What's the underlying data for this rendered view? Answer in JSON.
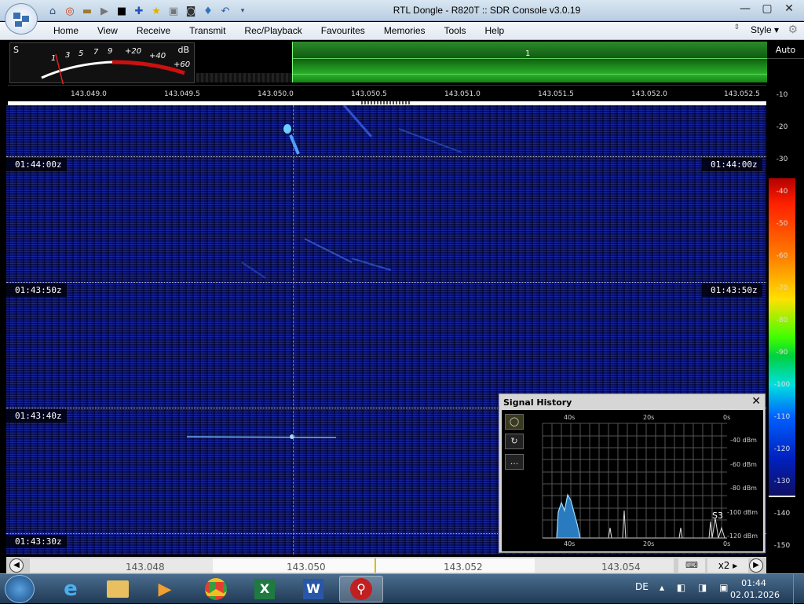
{
  "window": {
    "title": "RTL Dongle - R820T :: SDR Console v3.0.19",
    "minimize_icon": "minimize-icon",
    "maximize_icon": "maximize-icon",
    "close_icon": "close-icon"
  },
  "quick_access": [
    "home-icon",
    "lifebuoy-icon",
    "folder-icon",
    "play-icon",
    "stop-icon",
    "add-icon",
    "star-icon",
    "lock-icon",
    "camera-icon",
    "droplet-icon",
    "undo-icon",
    "dropdown-icon"
  ],
  "menu": {
    "items": [
      "Home",
      "View",
      "Receive",
      "Transmit",
      "Rec/Playback",
      "Favourites",
      "Memories",
      "Tools",
      "Help"
    ],
    "style_label": "Style"
  },
  "smeter": {
    "s_label": "S",
    "db_label": "dB",
    "scale": [
      "1",
      "3",
      "5",
      "7",
      "9",
      "+20",
      "+40",
      "+60"
    ],
    "needle_level": 0.07
  },
  "spectrum": {
    "band_label": "1",
    "freq_labels": [
      "143.049.0",
      "143.049.5",
      "143.050.0",
      "143.050.5",
      "143.051.0",
      "143.051.5",
      "143.052.0",
      "143.052.5"
    ]
  },
  "waterfall": {
    "timestamps": [
      "01:44:00z",
      "01:43:50z",
      "01:43:40z",
      "01:43:30z"
    ]
  },
  "signal_history": {
    "title": "Signal History",
    "buttons": [
      "record-icon",
      "refresh-icon",
      "more-icon"
    ],
    "more_label": "...",
    "top_time_labels": [
      "40s",
      "20s",
      "0s"
    ],
    "bottom_time_labels": [
      "40s",
      "20s",
      "0s"
    ],
    "dbm_labels": [
      "-40 dBm",
      "-60 dBm",
      "-80 dBm",
      "-100 dBm",
      "-120 dBm"
    ],
    "s_reading": "S3",
    "colors": {
      "trace": "#9fe0ff",
      "fill": "#2a7ac0"
    }
  },
  "db_scale": {
    "auto_label": "Auto",
    "ticks": [
      "-10",
      "-20",
      "-30",
      "-40",
      "-50",
      "-60",
      "-70",
      "-80",
      "-90",
      "-100",
      "-110",
      "-120",
      "-130",
      "-140",
      "-150"
    ]
  },
  "bottom_bar": {
    "freq_labels": [
      "143.048",
      "143.050",
      "143.052",
      "143.054"
    ],
    "zoom_label": "x2",
    "keyboard_icon": "keyboard-icon"
  },
  "taskbar": {
    "apps": [
      "internet-explorer-icon",
      "file-explorer-icon",
      "media-player-icon",
      "chrome-icon",
      "excel-icon",
      "word-icon",
      "sdr-console-icon"
    ],
    "language": "DE",
    "time": "01:44",
    "date": "02.01.2026"
  }
}
